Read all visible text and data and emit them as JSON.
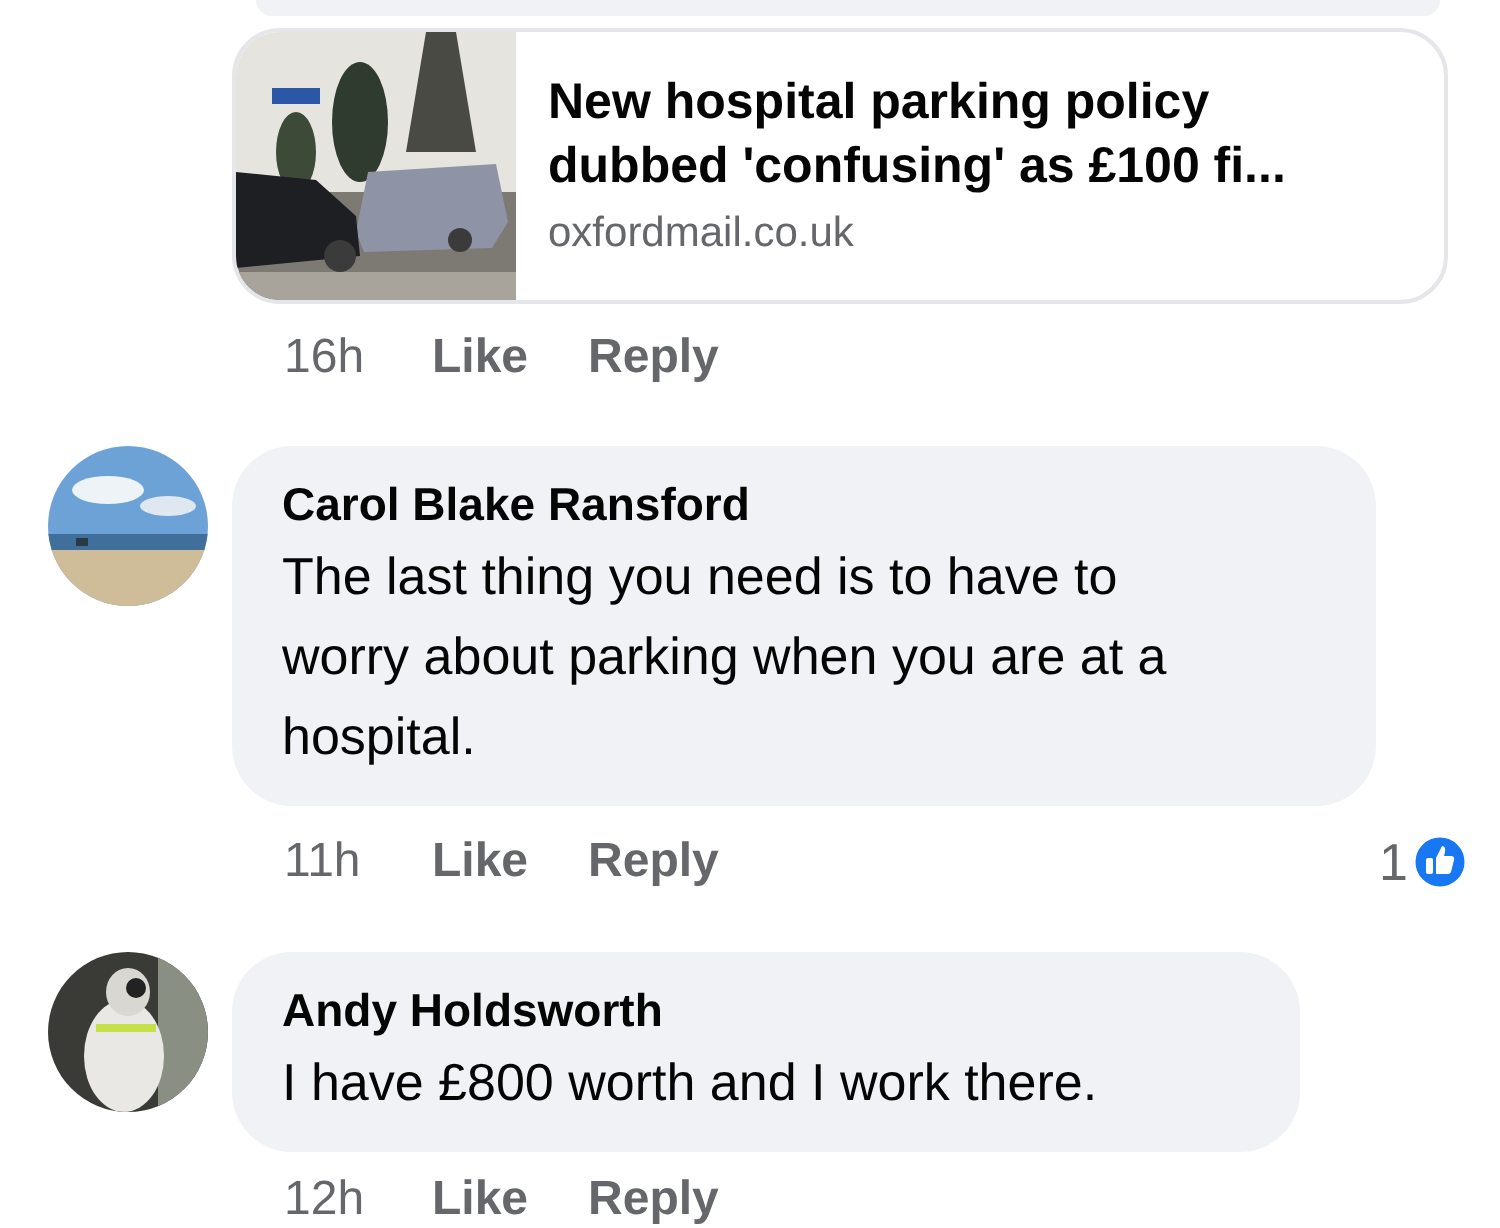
{
  "link_comment": {
    "link_preview": {
      "title": "New hospital parking policy dubbed 'confusing' as £100 fi...",
      "domain": "oxfordmail.co.uk"
    },
    "time": "16h",
    "like_label": "Like",
    "reply_label": "Reply"
  },
  "comments": [
    {
      "author": "Carol Blake Ransford",
      "text": "The last thing you need is to have to worry about parking when you are at a hospital.",
      "time": "11h",
      "like_label": "Like",
      "reply_label": "Reply",
      "reaction_count": "1"
    },
    {
      "author": "Andy Holdsworth",
      "text": "I have £800 worth and I work there.",
      "time": "12h",
      "like_label": "Like",
      "reply_label": "Reply"
    }
  ]
}
